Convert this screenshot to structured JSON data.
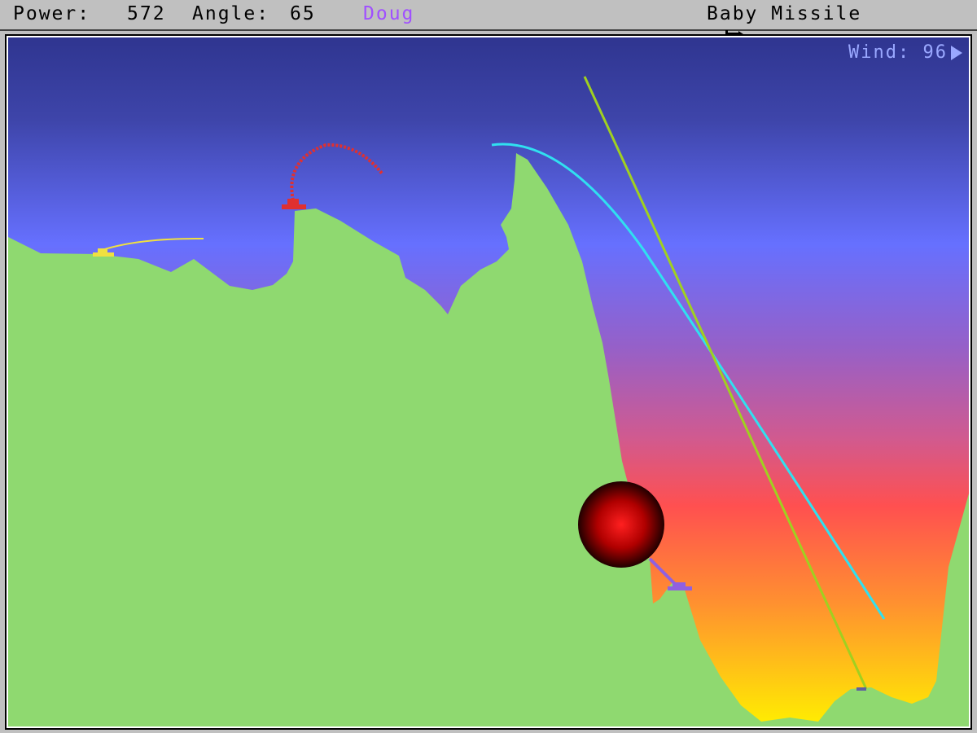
{
  "hud": {
    "power_label": "Power:",
    "power_value": "572",
    "angle_label": "Angle:",
    "angle_value": "65",
    "player_name": "Doug",
    "player_color": "#a050ff",
    "weapon_icon": "missile-icon",
    "weapon_name": "Baby Missile"
  },
  "wind": {
    "label": "Wind:",
    "value": "96",
    "direction_icon": "right-triangle-arrow-icon"
  },
  "colors": {
    "terrain": "#8fd970",
    "sky_top": "#2f3590",
    "sky_mid": "#6670ff",
    "sky_hot": "#ff5050",
    "sky_bottom": "#ffef00",
    "tank_yellow": "#f0e040",
    "tank_red": "#e03030",
    "tank_purple": "#9060e0",
    "trail_cyan": "#30e0f0",
    "trail_green": "#a0d020",
    "explosion": "#ff0000"
  }
}
